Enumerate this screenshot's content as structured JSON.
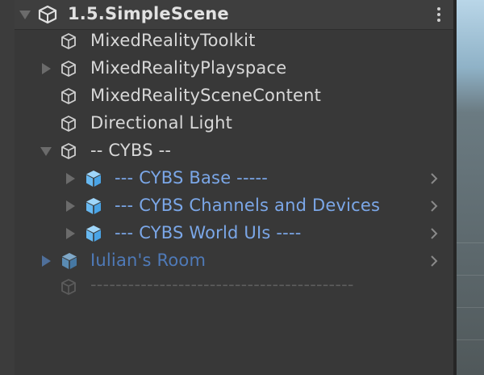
{
  "window": {
    "scene_title": "1.5.SimpleScene"
  },
  "hierarchy": {
    "items": [
      {
        "label": "MixedRealityToolkit",
        "type": "gameobject",
        "expand": "none"
      },
      {
        "label": "MixedRealityPlayspace",
        "type": "gameobject",
        "expand": "collapsed"
      },
      {
        "label": "MixedRealitySceneContent",
        "type": "gameobject",
        "expand": "none"
      },
      {
        "label": "Directional Light",
        "type": "gameobject",
        "expand": "none"
      },
      {
        "label": "-- CYBS --",
        "type": "gameobject",
        "expand": "expanded"
      },
      {
        "label": "--- CYBS Base -----",
        "type": "prefab",
        "expand": "collapsed"
      },
      {
        "label": "--- CYBS Channels and Devices",
        "type": "prefab",
        "expand": "collapsed"
      },
      {
        "label": "--- CYBS World UIs ----",
        "type": "prefab",
        "expand": "collapsed"
      },
      {
        "label": "Iulian's Room",
        "type": "prefab-inactive",
        "expand": "collapsed"
      },
      {
        "label": "------------------------------------------",
        "type": "gameobject-inactive",
        "expand": "none"
      }
    ]
  },
  "colors": {
    "text": "#d8d8d8",
    "prefab_text": "#7ba7e8",
    "prefab_inactive_text": "#4f7ab8",
    "inactive_text": "#5c5c5c",
    "prefab_icon": "#67b8f0",
    "panel_bg": "#383838"
  },
  "icons": {
    "scene": "unity-scene-icon",
    "gameobject": "cube-outline-icon",
    "prefab": "prefab-cube-icon",
    "menu": "kebab-menu-icon",
    "open_prefab": "chevron-right-icon"
  }
}
